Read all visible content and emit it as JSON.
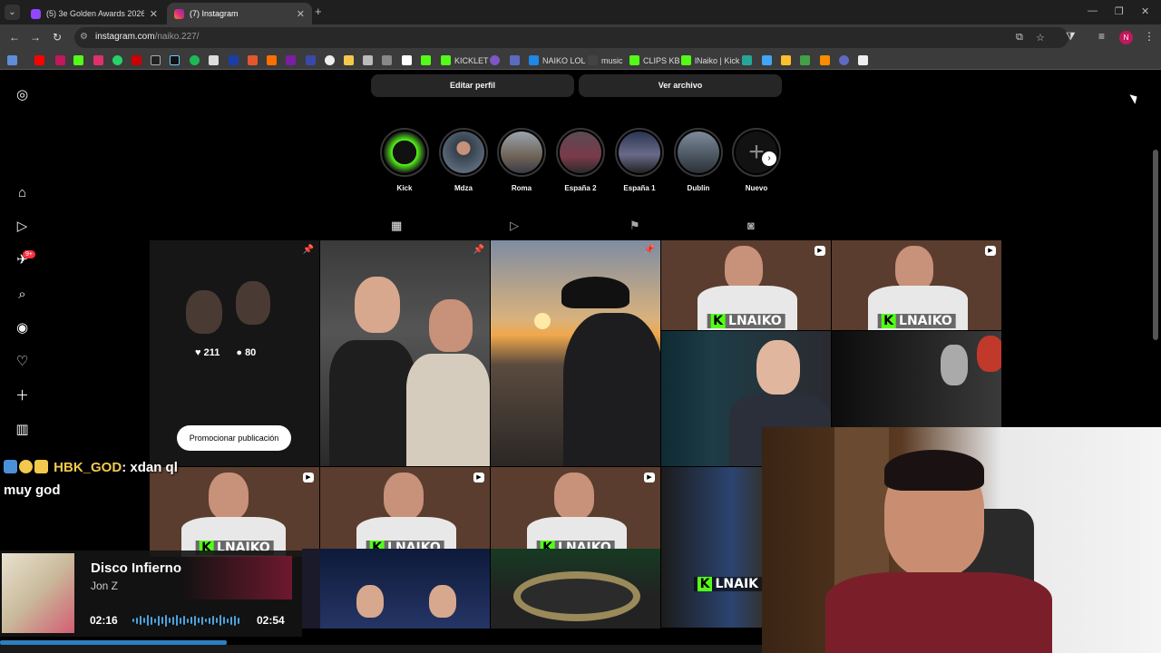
{
  "browser": {
    "tabs": [
      {
        "title": "(5) 3e Golden Awards 2026 ✨",
        "favicon_color": "#9146ff"
      },
      {
        "title": "(7) Instagram",
        "favicon_color": "#e1306c"
      }
    ],
    "url_host": "instagram.com",
    "url_path": "/naiko.227/",
    "profile_initial": "N",
    "bookmarks": [
      "KICKLET",
      "NAIKO LOL",
      "music",
      "CLIPS KB",
      "lNaiko | Kick"
    ]
  },
  "profile": {
    "edit_profile_label": "Editar perfil",
    "archive_label": "Ver archivo",
    "highlights": [
      {
        "label": "Kick",
        "color": "#53fc18"
      },
      {
        "label": "Mdza",
        "color": "#4a5a6a"
      },
      {
        "label": "Roma",
        "color": "#8a7a6a"
      },
      {
        "label": "España 2",
        "color": "#6a4a5a"
      },
      {
        "label": "España 1",
        "color": "#3a4a6a"
      },
      {
        "label": "Dublin",
        "color": "#5a6a7a"
      },
      {
        "label": "Nuevo",
        "color": "#121212"
      }
    ],
    "tabs": [
      "posts",
      "reels",
      "saved",
      "tagged"
    ]
  },
  "posts": {
    "likes": "211",
    "comments": "80",
    "promote_label": "Promocionar publicación",
    "kick_watermark": "LNAIKO",
    "kick_watermark_cut": "LNAIK"
  },
  "stream": {
    "chat_user": "HBK_GOD",
    "chat_message": ": xdan ql",
    "chat_message_2": "muy god",
    "now_playing": {
      "song": "Disco Infierno",
      "artist": "Jon Z",
      "elapsed": "02:16",
      "total": "02:54",
      "progress": 0.78
    }
  },
  "colors": {
    "kick_green": "#53fc18",
    "notification_red": "#ff3040",
    "instagram_bg": "#000000",
    "button_bg": "#262626"
  },
  "notifications_badge": "9+"
}
